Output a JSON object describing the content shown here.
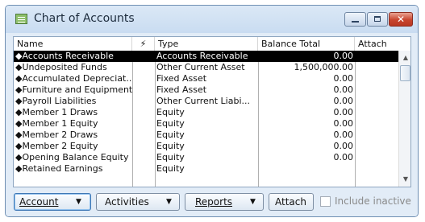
{
  "window": {
    "title": "Chart of Accounts",
    "icon": "chart-of-accounts-icon",
    "close_glyph": "✕"
  },
  "table": {
    "headers": {
      "name": "Name",
      "flag": "⚡",
      "type": "Type",
      "balance": "Balance Total",
      "attach": "Attach"
    },
    "rows": [
      {
        "name": "◆Accounts Receivable",
        "type": "Accounts Receivable",
        "balance": "0.00",
        "selected": true
      },
      {
        "name": "◆Undeposited Funds",
        "type": "Other Current Asset",
        "balance": "1,500,000.00"
      },
      {
        "name": "◆Accumulated Depreciat...",
        "type": "Fixed Asset",
        "balance": "0.00"
      },
      {
        "name": "◆Furniture and Equipment",
        "type": "Fixed Asset",
        "balance": "0.00"
      },
      {
        "name": "◆Payroll Liabilities",
        "type": "Other Current Liabi...",
        "balance": "0.00"
      },
      {
        "name": "◆Member 1 Draws",
        "type": "Equity",
        "balance": "0.00"
      },
      {
        "name": "◆Member 1 Equity",
        "type": "Equity",
        "balance": "0.00"
      },
      {
        "name": "◆Member 2 Draws",
        "type": "Equity",
        "balance": "0.00"
      },
      {
        "name": "◆Member 2 Equity",
        "type": "Equity",
        "balance": "0.00"
      },
      {
        "name": "◆Opening Balance Equity",
        "type": "Equity",
        "balance": "0.00"
      },
      {
        "name": "◆Retained Earnings",
        "type": "Equity",
        "balance": ""
      }
    ]
  },
  "scrollbar": {
    "up_glyph": "▲",
    "down_glyph": "▼"
  },
  "footer": {
    "account_label": "Account",
    "activities_label": "Activities",
    "reports_label": "Reports",
    "attach_label": "Attach",
    "include_inactive_label": "Include inactive",
    "include_inactive_checked": false,
    "caret": "▼"
  }
}
